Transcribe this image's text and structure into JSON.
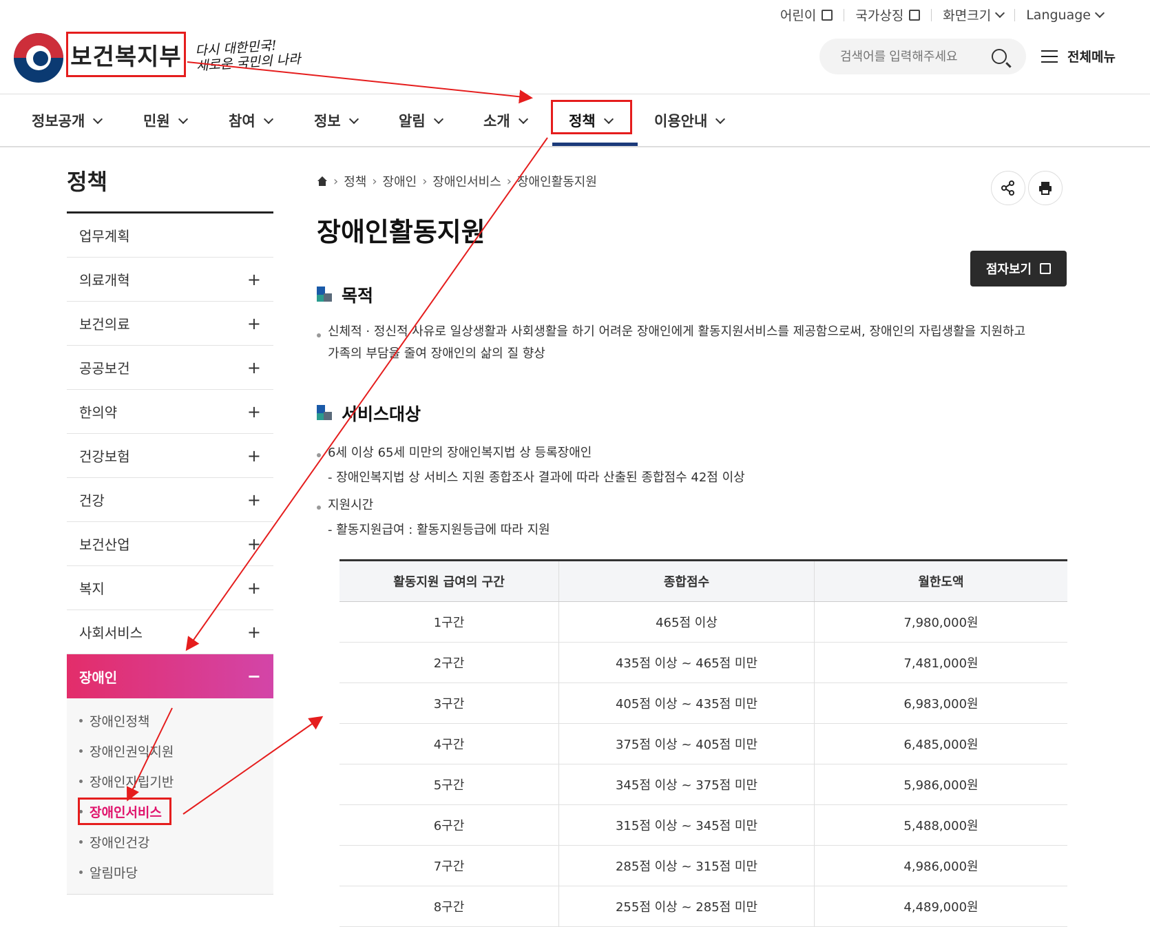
{
  "topbar": {
    "kids": "어린이",
    "symbols": "국가상징",
    "zoom": "화면크기",
    "language": "Language"
  },
  "header": {
    "logo": "보건복지부",
    "slogan_line1": "다시 대한민국!",
    "slogan_line2": "새로운 국민의 나라"
  },
  "search": {
    "placeholder": "검색어를 입력해주세요"
  },
  "allmenu": {
    "label": "전체메뉴"
  },
  "gnb": [
    {
      "label": "정보공개"
    },
    {
      "label": "민원"
    },
    {
      "label": "참여"
    },
    {
      "label": "정보"
    },
    {
      "label": "알림"
    },
    {
      "label": "소개"
    },
    {
      "label": "정책"
    },
    {
      "label": "이용안내"
    }
  ],
  "lnb": {
    "title": "정책",
    "items": [
      {
        "label": "업무계획"
      },
      {
        "label": "의료개혁"
      },
      {
        "label": "보건의료"
      },
      {
        "label": "공공보건"
      },
      {
        "label": "한의약"
      },
      {
        "label": "건강보험"
      },
      {
        "label": "건강"
      },
      {
        "label": "보건산업"
      },
      {
        "label": "복지"
      },
      {
        "label": "사회서비스"
      }
    ],
    "active": "장애인",
    "sub": [
      {
        "label": "장애인정책"
      },
      {
        "label": "장애인권익지원"
      },
      {
        "label": "장애인자립기반"
      },
      {
        "label": "장애인서비스"
      },
      {
        "label": "장애인건강"
      },
      {
        "label": "알림마당"
      }
    ]
  },
  "breadcrumb": [
    "정책",
    "장애인",
    "장애인서비스",
    "장애인활동지원"
  ],
  "page": {
    "title": "장애인활동지원",
    "braille": "점자보기",
    "purpose_heading": "목적",
    "purpose_line1": "신체적 · 정신적 사유로 일상생활과 사회생활을 하기 어려운 장애인에게 활동지원서비스를 제공함으로써, 장애인의 자립생활을 지원하고",
    "purpose_line2": "가족의 부담을 줄여 장애인의 삶의 질 향상",
    "target_heading": "서비스대상",
    "target_1": "6세 이상 65세 미만의 장애인복지법 상 등록장애인",
    "target_1_sub": "- 장애인복지법 상 서비스 지원 종합조사 결과에 따라 산출된 종합점수 42점 이상",
    "target_2": "지원시간",
    "target_2_sub": "- 활동지원급여 : 활동지원등급에 따라 지원"
  },
  "table": {
    "headers": [
      "활동지원 급여의 구간",
      "종합점수",
      "월한도액"
    ],
    "rows": [
      [
        "1구간",
        "465점 이상",
        "7,980,000원"
      ],
      [
        "2구간",
        "435점 이상 ~ 465점 미만",
        "7,481,000원"
      ],
      [
        "3구간",
        "405점 이상 ~ 435점 미만",
        "6,983,000원"
      ],
      [
        "4구간",
        "375점 이상 ~ 405점 미만",
        "6,485,000원"
      ],
      [
        "5구간",
        "345점 이상 ~ 375점 미만",
        "5,986,000원"
      ],
      [
        "6구간",
        "315점 이상 ~ 345점 미만",
        "5,488,000원"
      ],
      [
        "7구간",
        "285점 이상 ~ 315점 미만",
        "4,986,000원"
      ],
      [
        "8구간",
        "255점 이상 ~ 285점 미만",
        "4,489,000원"
      ]
    ]
  },
  "colors": {
    "accent": "#1b3a7a",
    "active_grad_start": "#e32d6a",
    "active_grad_end": "#d345a8",
    "annotation": "#e51d1d"
  }
}
